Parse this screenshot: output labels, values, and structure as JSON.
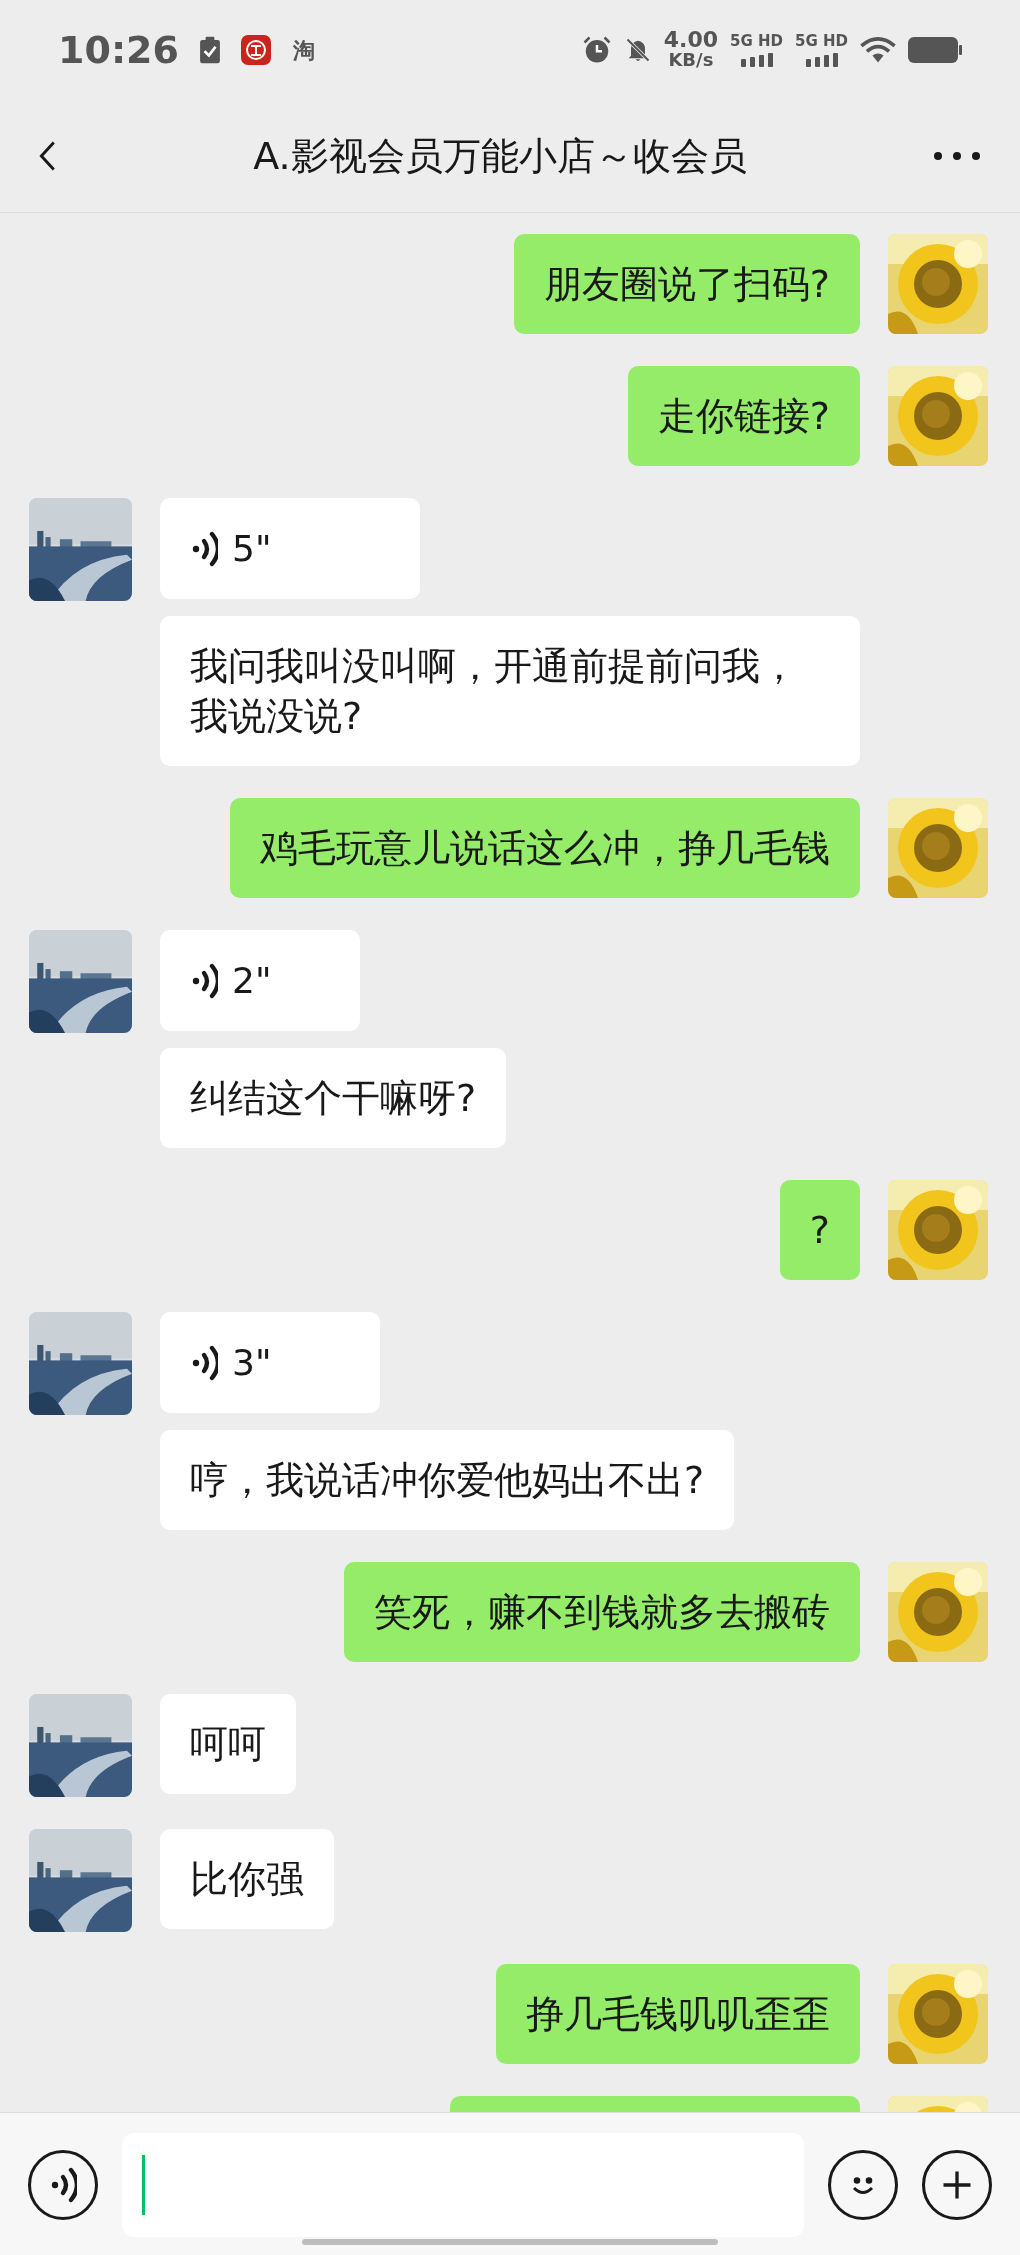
{
  "status_bar": {
    "time": "10:26",
    "app_label": "淘",
    "speed": "4.00",
    "speed_unit": "KB/s",
    "networks": [
      "5G HD",
      "5G HD"
    ]
  },
  "header": {
    "title": "A.影视会员万能小店～收会员"
  },
  "groups": [
    {
      "outgoing": true,
      "messages": [
        {
          "kind": "text",
          "text": "朋友圈说了扫码?"
        }
      ]
    },
    {
      "outgoing": true,
      "messages": [
        {
          "kind": "text",
          "text": "走你链接?"
        }
      ]
    },
    {
      "outgoing": false,
      "messages": [
        {
          "kind": "voice",
          "duration": "5\""
        },
        {
          "kind": "text",
          "text": "我问我叫没叫啊，开通前提前问我，我说没说?"
        }
      ]
    },
    {
      "outgoing": true,
      "messages": [
        {
          "kind": "text",
          "text": "鸡毛玩意儿说话这么冲，挣几毛钱"
        }
      ]
    },
    {
      "outgoing": false,
      "messages": [
        {
          "kind": "voice",
          "duration": "2\""
        },
        {
          "kind": "text",
          "text": "纠结这个干嘛呀?"
        }
      ]
    },
    {
      "outgoing": true,
      "messages": [
        {
          "kind": "text",
          "text": "?"
        }
      ]
    },
    {
      "outgoing": false,
      "messages": [
        {
          "kind": "voice",
          "duration": "3\""
        },
        {
          "kind": "text",
          "text": "哼，我说话冲你爱他妈出不出?"
        }
      ]
    },
    {
      "outgoing": true,
      "messages": [
        {
          "kind": "text",
          "text": "笑死，赚不到钱就多去搬砖"
        }
      ]
    },
    {
      "outgoing": false,
      "messages": [
        {
          "kind": "text",
          "text": "呵呵"
        }
      ]
    },
    {
      "outgoing": false,
      "messages": [
        {
          "kind": "text",
          "text": "比你强"
        }
      ]
    },
    {
      "outgoing": true,
      "messages": [
        {
          "kind": "text",
          "text": "挣几毛钱叽叽歪歪"
        }
      ]
    },
    {
      "outgoing": true,
      "messages": [
        {
          "kind": "cut"
        }
      ]
    }
  ]
}
